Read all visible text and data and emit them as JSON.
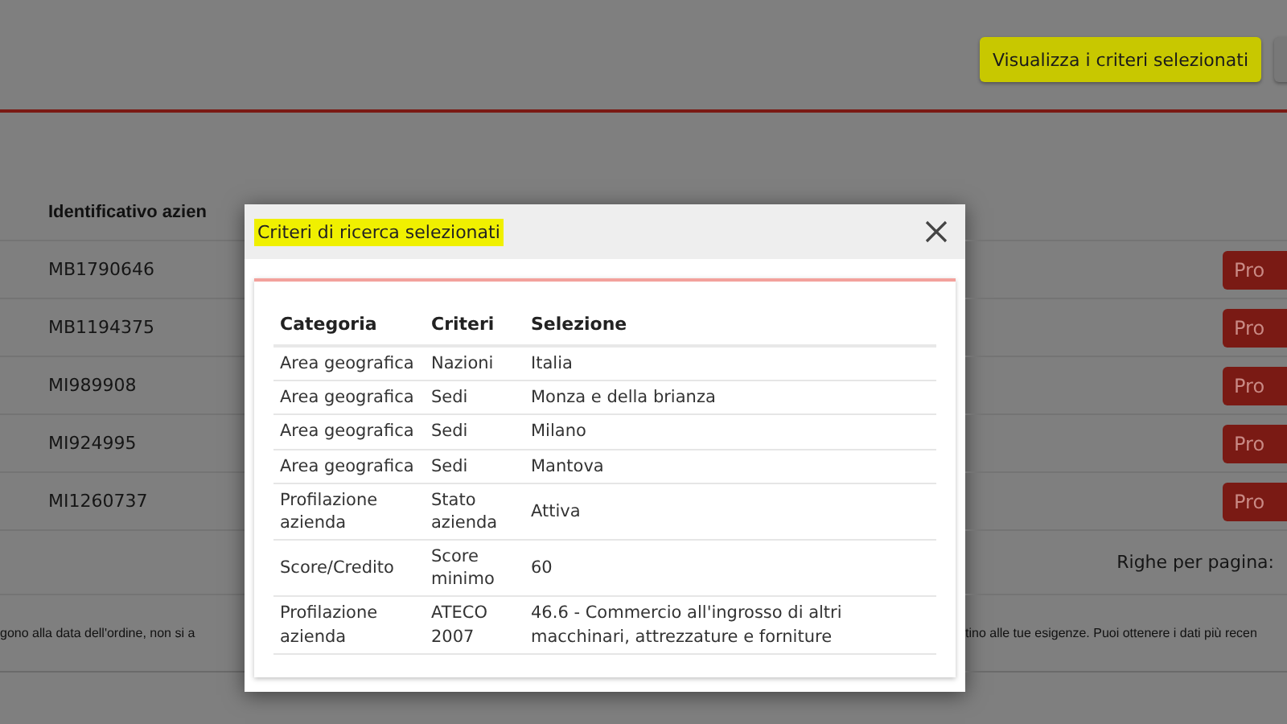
{
  "header": {
    "button": {
      "label": "Visualizza i criteri selezionati",
      "highlighted": true
    }
  },
  "table": {
    "column_heading": "Identificativo azien",
    "rows": [
      {
        "id": "MB1790646",
        "action": "Pro"
      },
      {
        "id": "MB1194375",
        "action": "Pro"
      },
      {
        "id": "MI989908",
        "action": "Pro"
      },
      {
        "id": "MI924995",
        "action": "Pro"
      },
      {
        "id": "MI1260737",
        "action": "Pro"
      }
    ],
    "pager_label": "Righe per pagina:"
  },
  "note_left": "gono alla data dell'ordine, non si a",
  "note_right": "tino alle tue esigenze. Puoi ottenere i dati più recen",
  "modal": {
    "title": "Criteri di ricerca selezionati",
    "title_highlighted": true,
    "columns": [
      "Categoria",
      "Criteri",
      "Selezione"
    ],
    "rows": [
      [
        "Area geografica",
        "Nazioni",
        "Italia"
      ],
      [
        "Area geografica",
        "Sedi",
        "Monza e della brianza"
      ],
      [
        "Area geografica",
        "Sedi",
        "Milano"
      ],
      [
        "Area geografica",
        "Sedi",
        "Mantova"
      ],
      [
        "Profilazione azienda",
        "Stato azienda",
        "Attiva"
      ],
      [
        "Score/Credito",
        "Score minimo",
        "60"
      ],
      [
        "Profilazione azienda",
        "ATECO 2007",
        "46.6 - Commercio all'ingrosso di altri macchinari, attrezzature e forniture"
      ]
    ]
  }
}
